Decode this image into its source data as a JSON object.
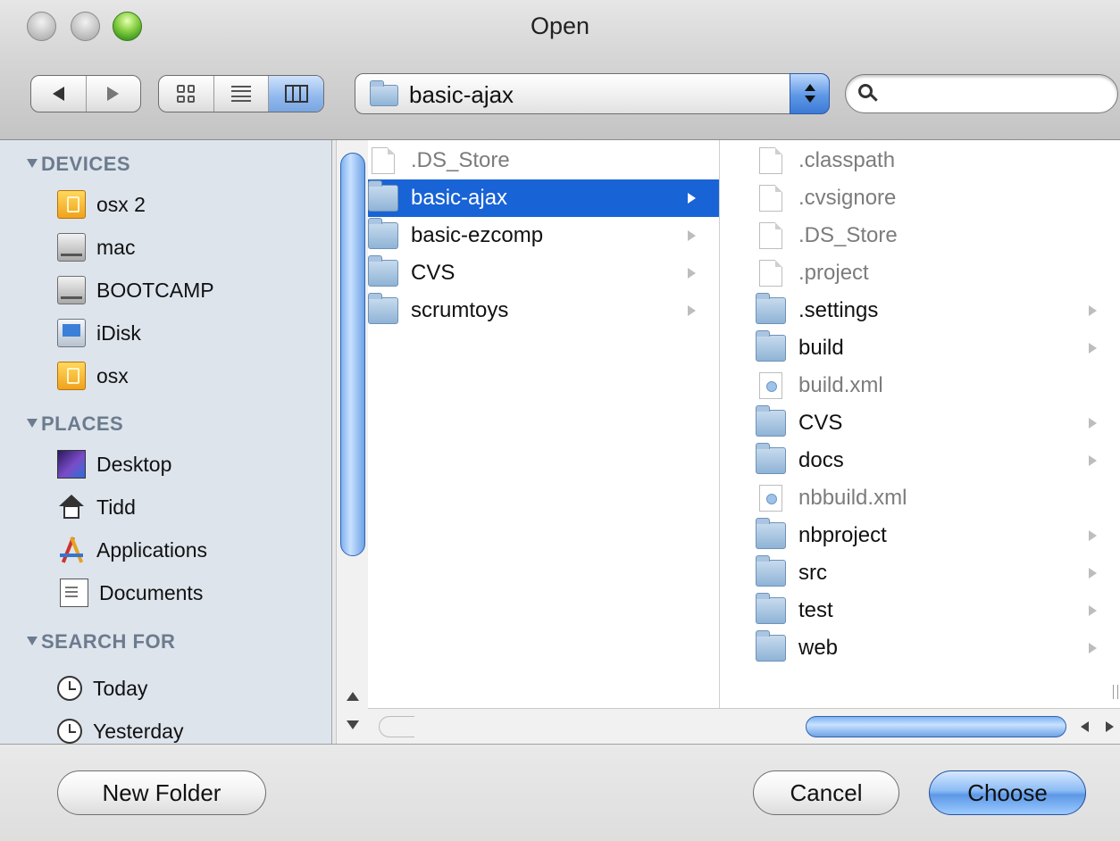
{
  "window": {
    "title": "Open"
  },
  "toolbar": {
    "path_popup": {
      "label": "basic-ajax"
    },
    "search": {
      "placeholder": ""
    }
  },
  "sidebar": {
    "sections": [
      {
        "header": "DEVICES",
        "items": [
          {
            "label": "osx 2",
            "icon": "usb-drive-icon"
          },
          {
            "label": "mac",
            "icon": "hard-drive-icon"
          },
          {
            "label": "BOOTCAMP",
            "icon": "hard-drive-icon"
          },
          {
            "label": "iDisk",
            "icon": "idisk-icon"
          },
          {
            "label": "osx",
            "icon": "usb-drive-icon"
          }
        ]
      },
      {
        "header": "PLACES",
        "items": [
          {
            "label": "Desktop",
            "icon": "desktop-icon"
          },
          {
            "label": "Tidd",
            "icon": "home-icon"
          },
          {
            "label": "Applications",
            "icon": "applications-icon"
          },
          {
            "label": "Documents",
            "icon": "documents-icon"
          }
        ]
      },
      {
        "header": "SEARCH FOR",
        "items": [
          {
            "label": "Today",
            "icon": "clock-icon"
          },
          {
            "label": "Yesterday",
            "icon": "clock-icon"
          }
        ]
      }
    ]
  },
  "columns": {
    "col1": [
      {
        "name": ".DS_Store",
        "kind": "file",
        "dim": true
      },
      {
        "name": "basic-ajax",
        "kind": "folder",
        "selected": true
      },
      {
        "name": "basic-ezcomp",
        "kind": "folder"
      },
      {
        "name": "CVS",
        "kind": "folder"
      },
      {
        "name": "scrumtoys",
        "kind": "folder"
      }
    ],
    "col2": [
      {
        "name": ".classpath",
        "kind": "file",
        "dim": true
      },
      {
        "name": ".cvsignore",
        "kind": "file",
        "dim": true
      },
      {
        "name": ".DS_Store",
        "kind": "file",
        "dim": true
      },
      {
        "name": ".project",
        "kind": "file",
        "dim": true
      },
      {
        "name": ".settings",
        "kind": "folder"
      },
      {
        "name": "build",
        "kind": "folder"
      },
      {
        "name": "build.xml",
        "kind": "xml",
        "dim": true
      },
      {
        "name": "CVS",
        "kind": "folder"
      },
      {
        "name": "docs",
        "kind": "folder"
      },
      {
        "name": "nbbuild.xml",
        "kind": "xml",
        "dim": true
      },
      {
        "name": "nbproject",
        "kind": "folder"
      },
      {
        "name": "src",
        "kind": "folder"
      },
      {
        "name": "test",
        "kind": "folder"
      },
      {
        "name": "web",
        "kind": "folder"
      }
    ]
  },
  "buttons": {
    "new_folder": "New Folder",
    "cancel": "Cancel",
    "choose": "Choose"
  },
  "colors": {
    "selection": "#1863d6",
    "sidebar_bg": "#dde4ec",
    "sidebar_header": "#6c7b8e"
  }
}
